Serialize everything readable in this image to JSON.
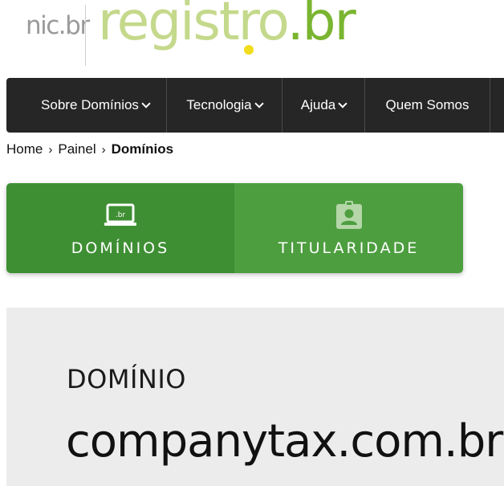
{
  "logo": {
    "nic": "nic.br",
    "registro": "registro",
    "registro_tld": ".br"
  },
  "nav": {
    "items": [
      {
        "label": "Sobre Domínios",
        "has_dropdown": true
      },
      {
        "label": "Tecnologia",
        "has_dropdown": true
      },
      {
        "label": "Ajuda",
        "has_dropdown": true
      },
      {
        "label": "Quem Somos",
        "has_dropdown": false
      }
    ]
  },
  "breadcrumb": {
    "home": "Home",
    "painel": "Painel",
    "current": "Domínios"
  },
  "tabs": [
    {
      "label": "DOMÍNIOS",
      "icon": "laptop-br-icon",
      "active": true
    },
    {
      "label": "TITULARIDADE",
      "icon": "id-badge-icon",
      "active": false
    }
  ],
  "panel": {
    "label": "DOMÍNIO",
    "value": "companytax.com.br"
  },
  "colors": {
    "nav_bg": "#262626",
    "tab_active": "#3e8f33",
    "tab_inactive": "#4d9e3f",
    "logo_light_green": "#c4d98b",
    "logo_green": "#7ab531",
    "logo_dot_yellow": "#f1dd1c",
    "panel_bg": "#ececec"
  }
}
